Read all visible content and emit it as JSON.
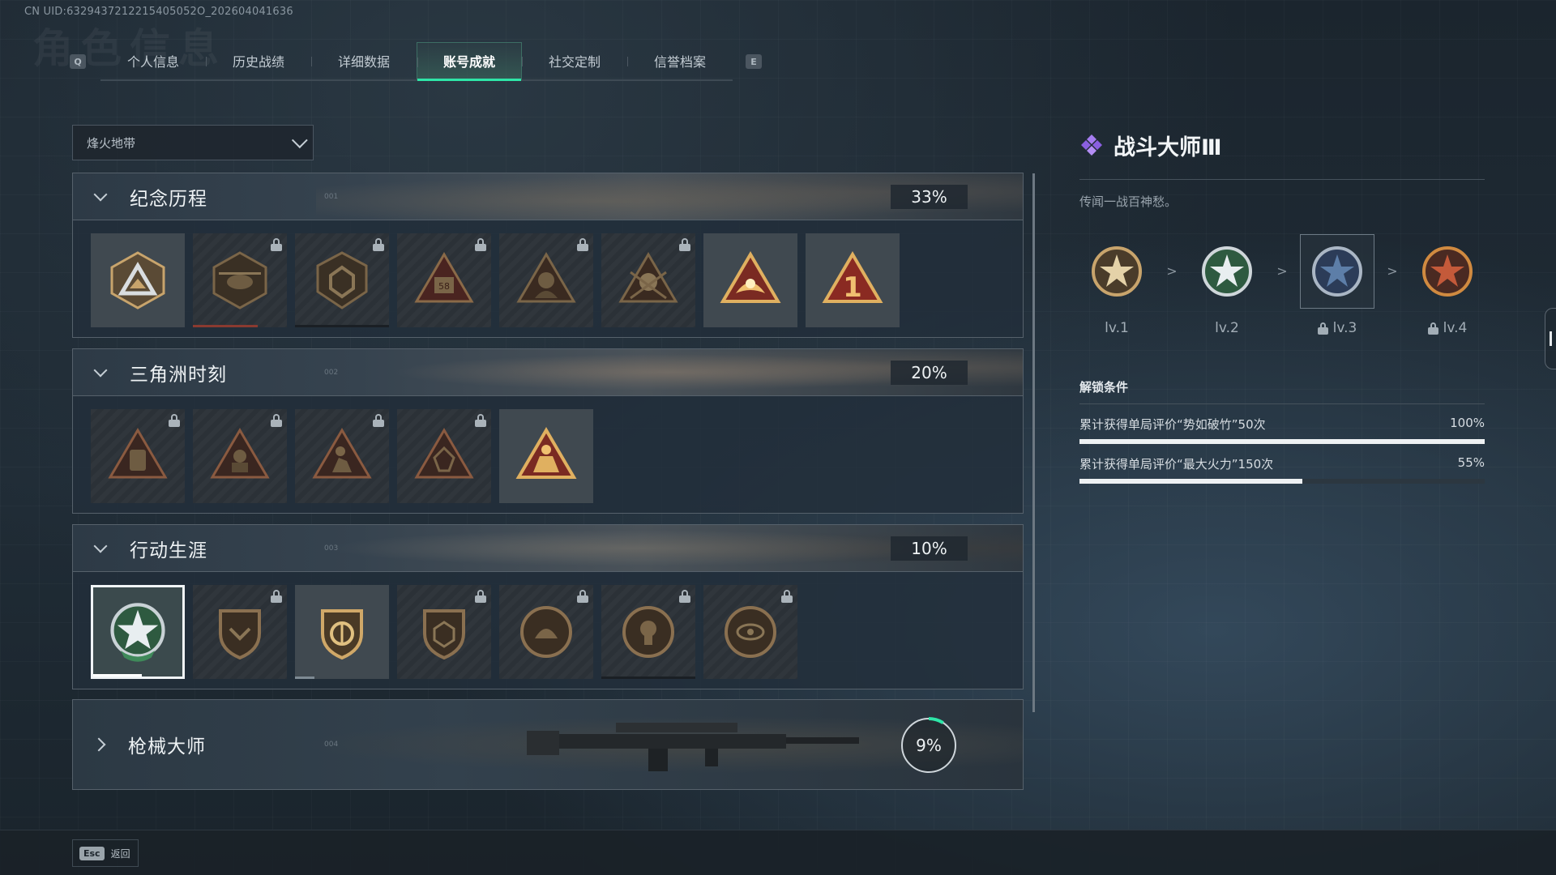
{
  "uid": "CN UID:6329437212215405052O_202604041636",
  "watermark": "角色信息",
  "tabs": {
    "prev_key": "Q",
    "next_key": "E",
    "items": [
      {
        "label": "个人信息",
        "active": false
      },
      {
        "label": "历史战绩",
        "active": false
      },
      {
        "label": "详细数据",
        "active": false
      },
      {
        "label": "账号成就",
        "active": true
      },
      {
        "label": "社交定制",
        "active": false
      },
      {
        "label": "信誉档案",
        "active": false
      }
    ]
  },
  "mode_select": {
    "value": "烽火地带"
  },
  "sections": [
    {
      "title": "纪念历程",
      "code": "001",
      "percent": "33%",
      "expanded": true,
      "medals": [
        {
          "icon": "triangle-peak-emblem",
          "locked": false
        },
        {
          "icon": "helicopter-emblem",
          "locked": true
        },
        {
          "icon": "shield-crest-emblem",
          "locked": true
        },
        {
          "icon": "vehicle-58-emblem",
          "locked": true
        },
        {
          "icon": "hooded-figure-emblem",
          "locked": true
        },
        {
          "icon": "skull-soldier-emblem",
          "locked": true
        },
        {
          "icon": "golden-wreath-emblem",
          "locked": false
        },
        {
          "icon": "number-one-emblem",
          "locked": false
        }
      ]
    },
    {
      "title": "三角洲时刻",
      "code": "002",
      "percent": "20%",
      "expanded": true,
      "medals": [
        {
          "icon": "backpack-emblem",
          "locked": true
        },
        {
          "icon": "squad-emblem",
          "locked": true
        },
        {
          "icon": "kneeling-soldier-emblem",
          "locked": true
        },
        {
          "icon": "wreath-emblem",
          "locked": true
        },
        {
          "icon": "victory-soldiers-emblem",
          "locked": false
        }
      ]
    },
    {
      "title": "行动生涯",
      "code": "003",
      "percent": "10%",
      "expanded": true,
      "medals": [
        {
          "icon": "combat-master-star-emblem",
          "locked": false,
          "selected": true
        },
        {
          "icon": "ribbon-shield-emblem",
          "locked": true
        },
        {
          "icon": "crossed-arrows-shield-emblem",
          "locked": false
        },
        {
          "icon": "dice-shield-emblem",
          "locked": true
        },
        {
          "icon": "shell-round-emblem",
          "locked": true
        },
        {
          "icon": "skull-round-emblem",
          "locked": true
        },
        {
          "icon": "eye-round-emblem",
          "locked": true
        }
      ]
    },
    {
      "title": "枪械大师",
      "code": "004",
      "percent": "9%",
      "percent_value": 9,
      "expanded": false
    }
  ],
  "detail": {
    "title": "战斗大师Ⅲ",
    "description": "传闻一战百神愁。",
    "levels": [
      {
        "label": "lv.1",
        "locked": false,
        "color": "#c8a46c"
      },
      {
        "label": "lv.2",
        "locked": false,
        "color": "#5fae78"
      },
      {
        "label": "lv.3",
        "locked": true,
        "color": "#5d7ea8",
        "current": true
      },
      {
        "label": "lv.4",
        "locked": true,
        "color": "#c45a3a"
      }
    ],
    "arrow": ">",
    "conditions_title": "解锁条件",
    "conditions": [
      {
        "text": "累计获得单局评价“势如破竹”50次",
        "percent": "100%",
        "value": 1.0
      },
      {
        "text": "累计获得单局评价“最大火力”150次",
        "percent": "55%",
        "value": 0.55
      }
    ]
  },
  "footer": {
    "key": "Esc",
    "label": "返回"
  },
  "colors": {
    "accent": "#2ee6a8",
    "title_icon": "#9d6ee8"
  }
}
